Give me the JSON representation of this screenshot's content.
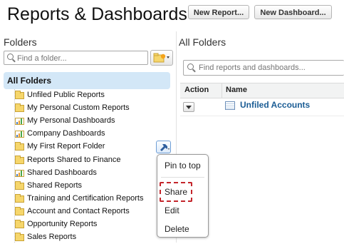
{
  "header": {
    "title": "Reports & Dashboards",
    "new_report_label": "New Report...",
    "new_dashboard_label": "New Dashboard..."
  },
  "sidebar": {
    "heading": "Folders",
    "search_placeholder": "Find a folder...",
    "all_folders_label": "All Folders",
    "items": [
      {
        "label": "Unfiled Public Reports",
        "icon": "folder-icon"
      },
      {
        "label": "My Personal Custom Reports",
        "icon": "folder-icon"
      },
      {
        "label": "My Personal Dashboards",
        "icon": "dashboard-folder-icon"
      },
      {
        "label": "Company Dashboards",
        "icon": "dashboard-folder-icon"
      },
      {
        "label": "My First Report Folder",
        "icon": "folder-icon"
      },
      {
        "label": "Reports Shared to Finance",
        "icon": "folder-icon"
      },
      {
        "label": "Shared Dashboards",
        "icon": "dashboard-folder-icon"
      },
      {
        "label": "Shared Reports",
        "icon": "folder-icon"
      },
      {
        "label": "Training and Certification Reports",
        "icon": "folder-icon"
      },
      {
        "label": "Account and Contact Reports",
        "icon": "folder-icon"
      },
      {
        "label": "Opportunity Reports",
        "icon": "folder-icon"
      },
      {
        "label": "Sales Reports",
        "icon": "folder-icon"
      }
    ]
  },
  "context_menu": {
    "items": [
      "Pin to top",
      "Share",
      "Edit",
      "Delete"
    ],
    "highlighted": "Share",
    "highlight_color": "#c4252b"
  },
  "main": {
    "heading": "All Folders",
    "search_placeholder": "Find reports and dashboards...",
    "columns": [
      "Action",
      "Name"
    ],
    "rows": [
      {
        "name": "Unfiled Accounts",
        "icon": "report-icon"
      }
    ]
  },
  "colors": {
    "selected_row_bg": "#d3e7f7",
    "link": "#1a5c94",
    "folder": "#f6d66b"
  }
}
